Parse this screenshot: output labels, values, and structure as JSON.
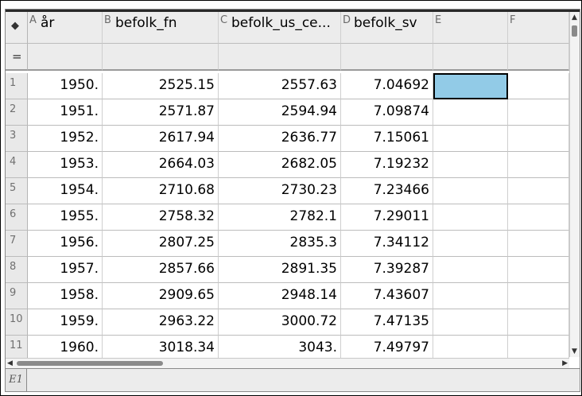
{
  "columns": [
    {
      "letter": "A",
      "name": "år"
    },
    {
      "letter": "B",
      "name": "befolk_fn"
    },
    {
      "letter": "C",
      "name": "befolk_us_ce..."
    },
    {
      "letter": "D",
      "name": "befolk_sv"
    },
    {
      "letter": "E",
      "name": ""
    },
    {
      "letter": "F",
      "name": ""
    }
  ],
  "formula_row_label": "=",
  "rows": [
    {
      "num": "1",
      "cells": [
        "1950.",
        "2525.15",
        "2557.63",
        "7.04692"
      ]
    },
    {
      "num": "2",
      "cells": [
        "1951.",
        "2571.87",
        "2594.94",
        "7.09874"
      ]
    },
    {
      "num": "3",
      "cells": [
        "1952.",
        "2617.94",
        "2636.77",
        "7.15061"
      ]
    },
    {
      "num": "4",
      "cells": [
        "1953.",
        "2664.03",
        "2682.05",
        "7.19232"
      ]
    },
    {
      "num": "5",
      "cells": [
        "1954.",
        "2710.68",
        "2730.23",
        "7.23466"
      ]
    },
    {
      "num": "6",
      "cells": [
        "1955.",
        "2758.32",
        "2782.1",
        "7.29011"
      ]
    },
    {
      "num": "7",
      "cells": [
        "1956.",
        "2807.25",
        "2835.3",
        "7.34112"
      ]
    },
    {
      "num": "8",
      "cells": [
        "1957.",
        "2857.66",
        "2891.35",
        "7.39287"
      ]
    },
    {
      "num": "9",
      "cells": [
        "1958.",
        "2909.65",
        "2948.14",
        "7.43607"
      ]
    },
    {
      "num": "10",
      "cells": [
        "1959.",
        "2963.22",
        "3000.72",
        "7.47135"
      ]
    },
    {
      "num": "11",
      "cells": [
        "1960.",
        "3018.34",
        "3043.",
        "7.49797"
      ]
    }
  ],
  "selected_cell": "E1",
  "entry_line": {
    "label": "E1",
    "value": ""
  },
  "colors": {
    "selection": "#92cbe7",
    "header_bg": "#ececec"
  }
}
